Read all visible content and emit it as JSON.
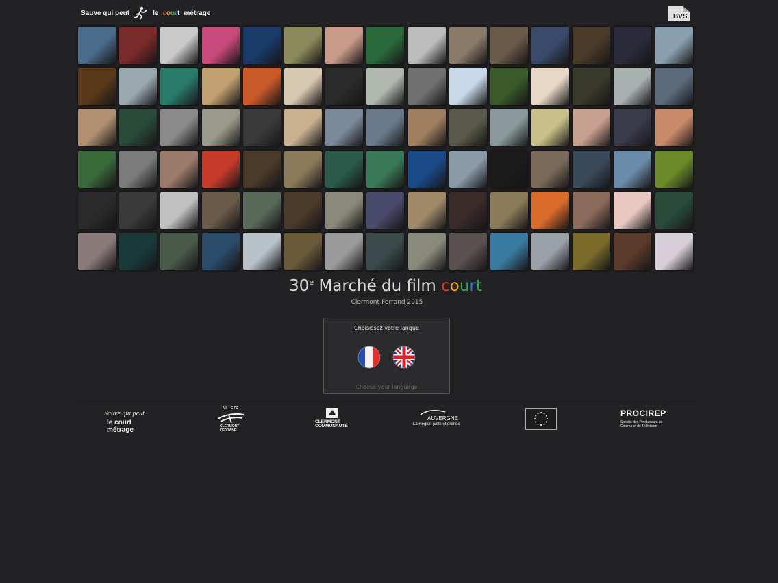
{
  "header": {
    "festival_logo": {
      "part1": "Sauve qui peut",
      "part2": "le",
      "court_letters": [
        "c",
        "o",
        "u",
        "r",
        "t"
      ],
      "part3": "métrage"
    },
    "bvs_logo_text": "BVS"
  },
  "thumbnails": [
    "#4a6b8a",
    "#7a2a2a",
    "#c9c9c9",
    "#c84a7a",
    "#1a3a6a",
    "#8a8a5a",
    "#c99a8a",
    "#2a6a3a",
    "#bdbdbd",
    "#8a7a6a",
    "#6a5a4a",
    "#3a4a6a",
    "#4a3a2a",
    "#2a2a3a",
    "#8aa0b0",
    "#5a3a1a",
    "#9aa8b0",
    "#2a7a6a",
    "#c0a070",
    "#c85a2a",
    "#d8c8b0",
    "#2a2a2a",
    "#b0b8b0",
    "#707070",
    "#c8d8e8",
    "#3a5a2a",
    "#e8d8c8",
    "#3a3a2a",
    "#a8b0b0",
    "#5a6a7a",
    "#b09070",
    "#2a4a3a",
    "#8a8a8a",
    "#9a9a8a",
    "#3a3a3a",
    "#c8b090",
    "#7a8a9a",
    "#6a7a8a",
    "#a08060",
    "#5a5a4a",
    "#8a9a9a",
    "#c8c088",
    "#c8a090",
    "#3a3a4a",
    "#c88a6a",
    "#3a6a3a",
    "#7a7a7a",
    "#9a7a6a",
    "#c83a2a",
    "#4a3a2a",
    "#8a7a5a",
    "#2a5a4a",
    "#3a7a5a",
    "#1a4a8a",
    "#8a9aa8",
    "#1a1a1a",
    "#7a6a5a",
    "#3a4a5a",
    "#6a8aa8",
    "#6a8a2a",
    "#2a2a2a",
    "#3a3a3a",
    "#c0c0c0",
    "#6a5a4a",
    "#5a6a5a",
    "#4a3a2a",
    "#8a8a7a",
    "#4a4a6a",
    "#a08a6a",
    "#3a2a2a",
    "#8a7a5a",
    "#d86a2a",
    "#8a6a5a",
    "#e8c8c0",
    "#2a4a3a",
    "#8a7a7a",
    "#1a3a3a",
    "#4a5a4a",
    "#2a4a6a",
    "#b8c0c8",
    "#6a5a3a",
    "#9a9a9a",
    "#3a4a4a",
    "#8a8a7a",
    "#5a5050",
    "#3a7aa0",
    "#9aa0a8",
    "#7a6a2a",
    "#5a3a2a",
    "#d8d0d8"
  ],
  "title": {
    "number": "30",
    "superscript": "e",
    "main": "Marché du film",
    "court_letters": [
      "c",
      "o",
      "u",
      "r",
      "t"
    ],
    "subtitle": "Clermont-Ferrand 2015"
  },
  "language": {
    "heading": "Choisissez votre langue",
    "subheading": "Choose your language"
  },
  "sponsors": {
    "s1_top": "Sauve qui peut",
    "s1_bottom": "le court métrage",
    "s2_top": "VILLE DE",
    "s2_bottom": "CLERMONT FERRAND",
    "s3_top": "CLERMONT",
    "s3_bottom": "COMMUNAUTÉ",
    "s4_top": "AUVERGNE",
    "s4_bottom": "La Région juste et grande",
    "s6_top": "PROCIREP",
    "s6_bottom": "Société des Producteurs de Cinéma et de Télévision"
  }
}
